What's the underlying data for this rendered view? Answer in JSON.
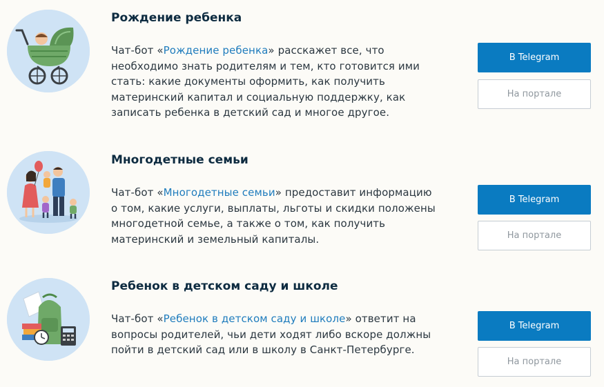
{
  "cards": [
    {
      "title": "Рождение ребенка",
      "desc_prefix": "Чат-бот «",
      "link_text": "Рождение ребенка",
      "desc_suffix": "» расскажет все, что необходимо знать родителям и тем, кто готовится ими стать: какие документы оформить, как получить материнский капитал и социальную поддержку, как записать ребенка в детский сад и многое другое.",
      "telegram_label": "В Telegram",
      "portal_label": "На портале",
      "icon": "baby-stroller-icon"
    },
    {
      "title": "Многодетные семьи",
      "desc_prefix": "Чат-бот «",
      "link_text": "Многодетные семьи",
      "desc_suffix": "» предоставит информацию о том, какие услуги, выплаты, льготы и скидки положены многодетной семье, а также о том, как получить материнский и земельный капиталы.",
      "telegram_label": "В Telegram",
      "portal_label": "На портале",
      "icon": "family-icon"
    },
    {
      "title": "Ребенок в детском саду и школе",
      "desc_prefix": "Чат-бот «",
      "link_text": "Ребенок в детском саду и школе",
      "desc_suffix": "» ответит на вопросы родителей, чьи дети ходят либо вскоре должны пойти в детский сад или в школу в Санкт-Петербурге.",
      "telegram_label": "В Telegram",
      "portal_label": "На портале",
      "icon": "school-backpack-icon"
    }
  ],
  "colors": {
    "accent": "#0a7bc1",
    "link": "#1f7cbd",
    "title": "#0d2b40",
    "circle": "#cfe3f5"
  }
}
